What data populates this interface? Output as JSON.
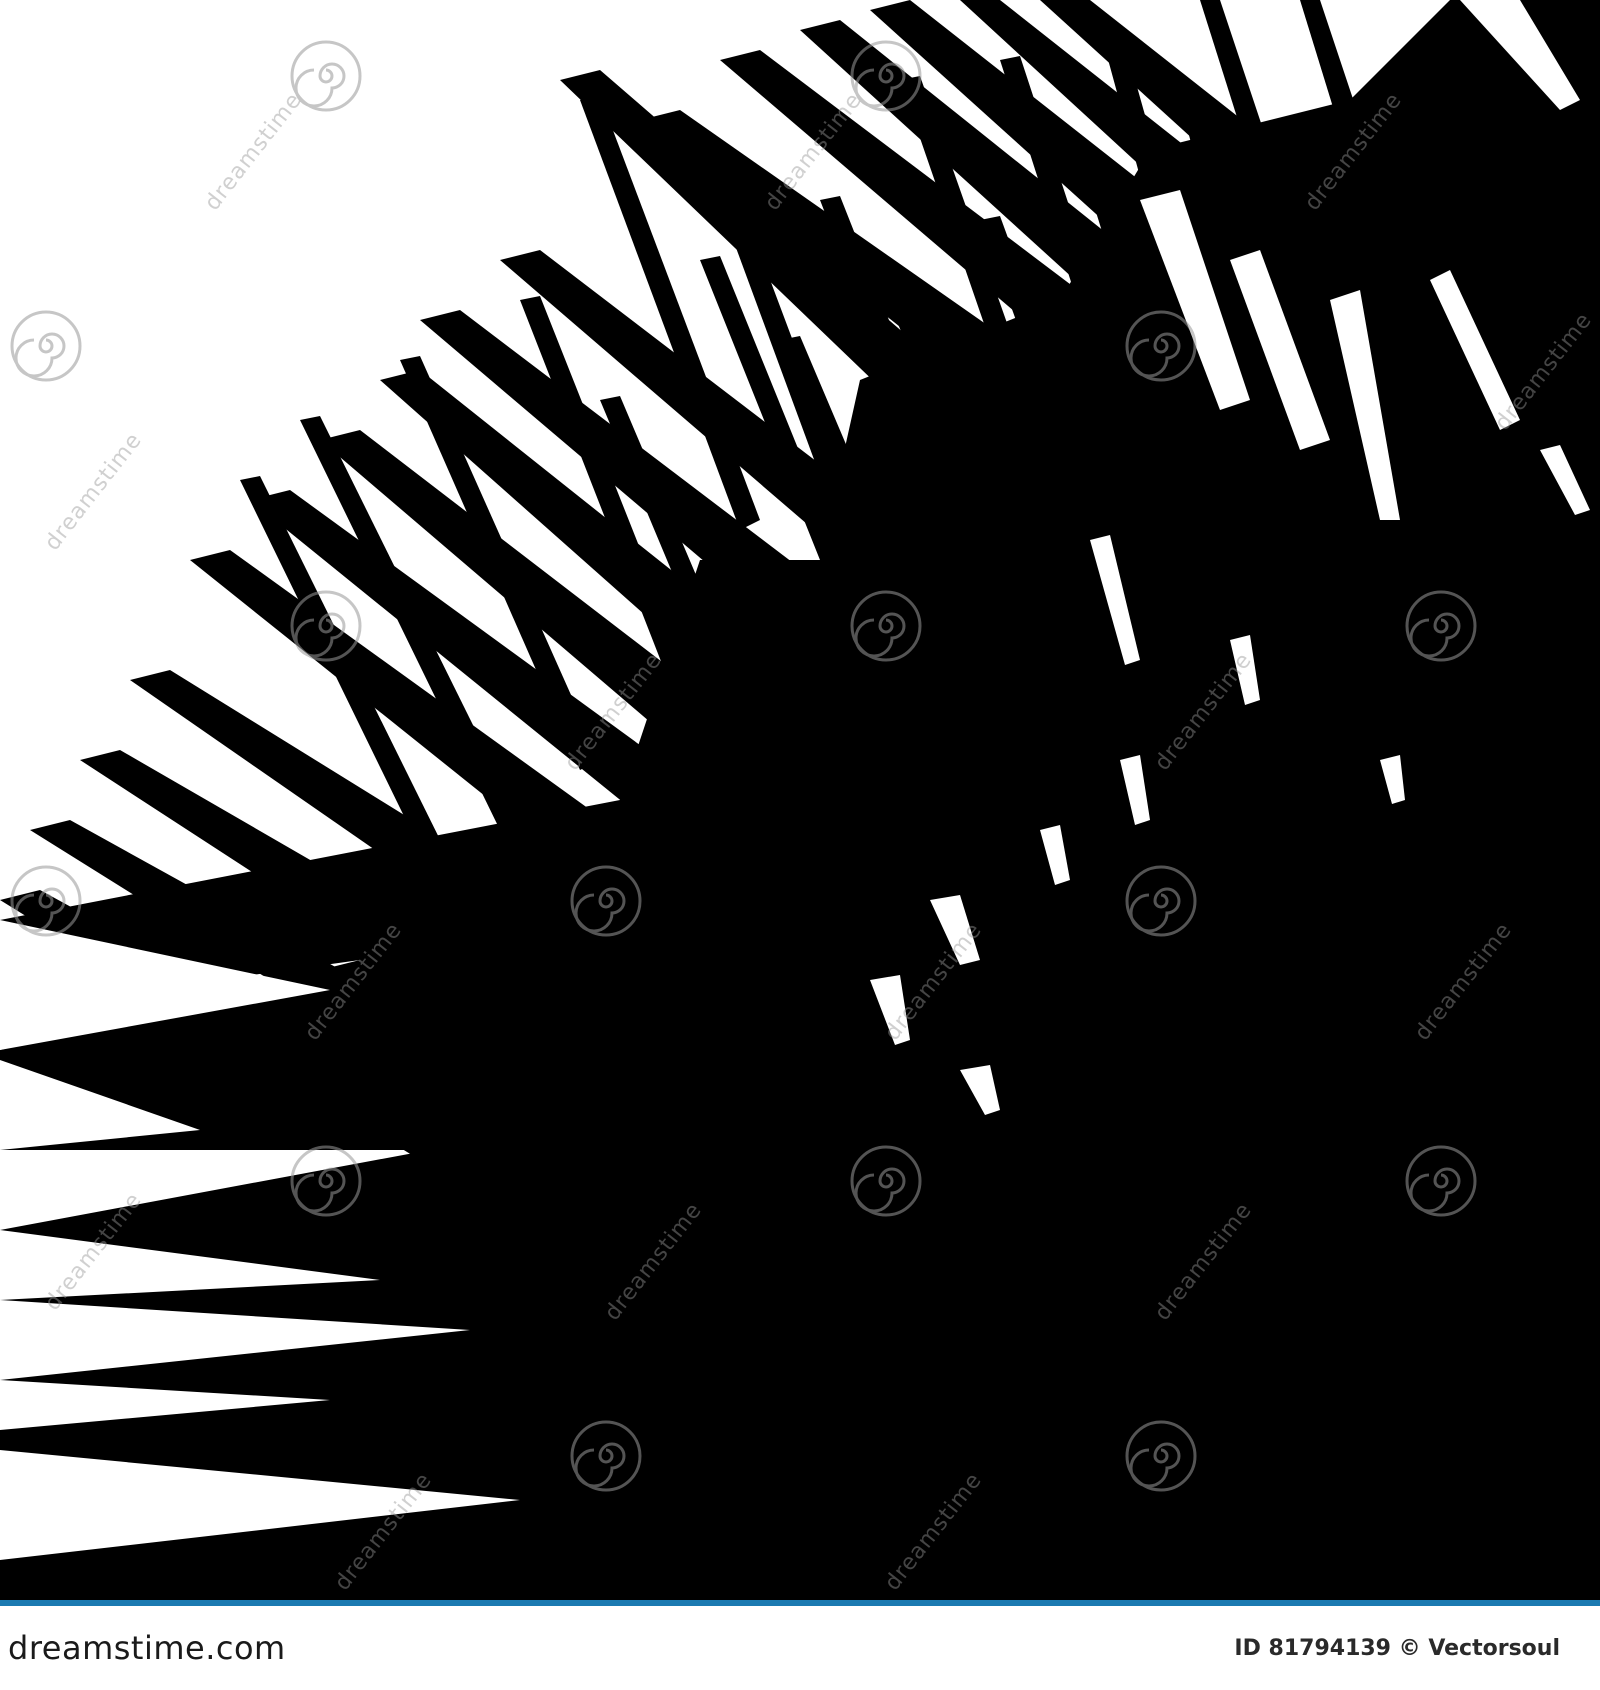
{
  "footer": {
    "brand": "dreamstime.com",
    "image_id": "ID 81794139",
    "copyright": "© Vectorsoul"
  },
  "watermark": {
    "text": "dreamstime"
  },
  "colors": {
    "footer_rule": "#1b7ab1",
    "ink": "#000000",
    "paper": "#ffffff"
  }
}
